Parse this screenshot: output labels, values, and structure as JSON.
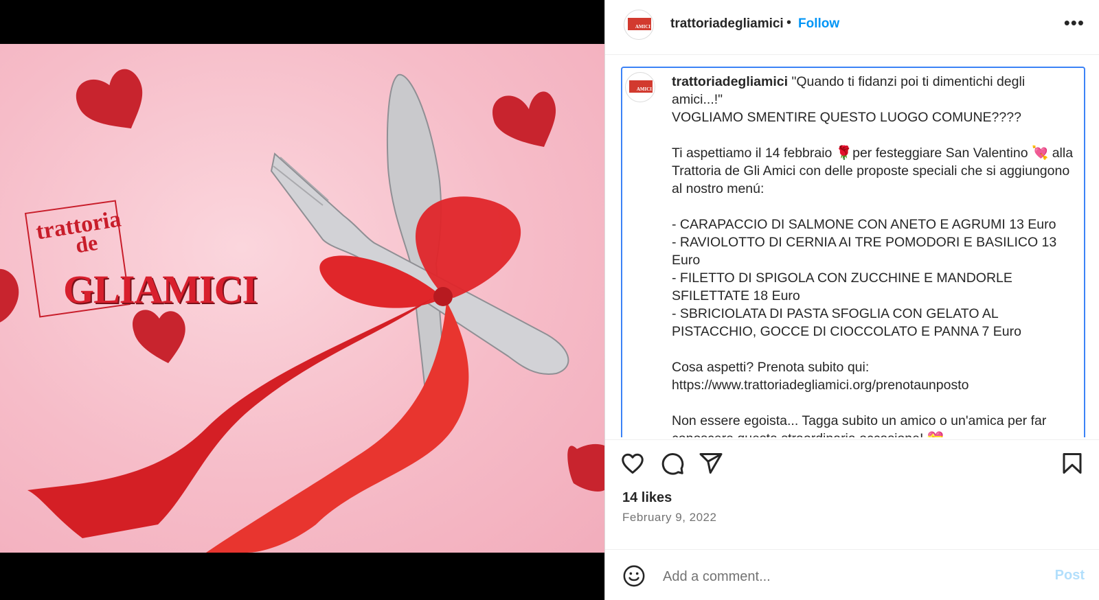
{
  "post": {
    "username": "trattoriadegliamici",
    "follow_label": "Follow",
    "separator": "•",
    "more_label": "•••"
  },
  "image": {
    "logo_line1": "trattoria",
    "logo_line2": "de",
    "logo_line3": "GLIAMICI"
  },
  "avatar": {
    "mini_text": "AMICI"
  },
  "caption": {
    "username": "trattoriadegliamici",
    "text": " \"Quando ti fidanzi poi ti dimentichi degli amici...!\"\nVOGLIAMO SMENTIRE QUESTO LUOGO COMUNE????\n\nTi aspettiamo il 14 febbraio 🌹per festeggiare San Valentino 💘 alla Trattoria de Gli Amici con delle proposte speciali che si aggiungono al nostro menú:\n\n- CARAPACCIO DI SALMONE CON ANETO E AGRUMI 13 Euro\n- RAVIOLOTTO DI CERNIA AI TRE POMODORI E BASILICO 13 Euro\n- FILETTO DI SPIGOLA CON ZUCCHINE E MANDORLE SFILETTATE 18 Euro\n- SBRICIOLATA DI PASTA SFOGLIA CON GELATO AL PISTACCHIO, GOCCE DI CIOCCOLATO E PANNA 7 Euro\n\nCosa aspetti? Prenota subito qui:\nhttps://www.trattoriadegliamici.org/prenotaunposto\n\nNon essere egoista... Tagga subito un amico o un'amica per far conoscere questa straordinaria occasione! 💝"
  },
  "stats": {
    "likes": "14 likes",
    "date": "February 9, 2022"
  },
  "comment": {
    "placeholder": "Add a comment...",
    "post_label": "Post"
  },
  "colors": {
    "accent": "#0095f6",
    "caption_border": "#3b82f6",
    "post_disabled": "#b2dffc",
    "brand_red": "#d81f2d"
  },
  "icons": [
    "heart-icon",
    "comment-icon",
    "share-icon",
    "bookmark-icon",
    "emoji-icon",
    "more-icon"
  ]
}
